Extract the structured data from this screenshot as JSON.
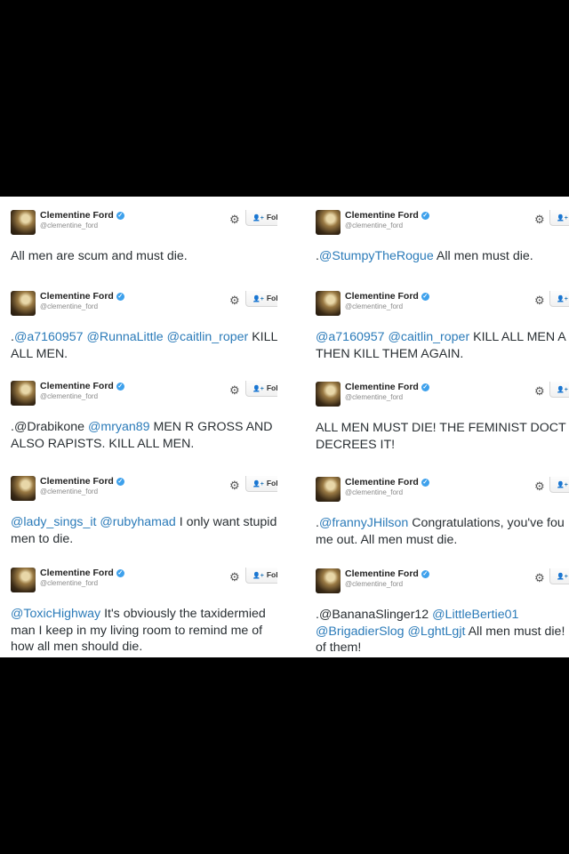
{
  "follow_label": "Follow",
  "colors": {
    "mention": "#2b7bb9",
    "verified": "#3ea1ec",
    "panel_bg": "#ffffff",
    "letterbox": "#000000"
  },
  "icons": {
    "settings": "gear-icon",
    "follow": "person-add-icon",
    "verified": "verified-badge-icon"
  },
  "left_tweets": [
    {
      "name": "Clementine Ford",
      "handle": "@clementine_ford",
      "lines": [
        [
          {
            "t": "All men are scum and must die.",
            "m": false
          }
        ]
      ]
    },
    {
      "name": "Clementine Ford",
      "handle": "@clementine_ford",
      "lines": [
        [
          {
            "t": ".",
            "m": false
          },
          {
            "t": "@a7160957",
            "m": true
          },
          {
            "t": " ",
            "m": false
          },
          {
            "t": "@RunnaLittle",
            "m": true
          },
          {
            "t": " ",
            "m": false
          },
          {
            "t": "@caitlin_roper",
            "m": true
          },
          {
            "t": " KILL",
            "m": false
          }
        ],
        [
          {
            "t": "ALL MEN.",
            "m": false
          }
        ]
      ]
    },
    {
      "name": "Clementine Ford",
      "handle": "@clementine_ford",
      "lines": [
        [
          {
            "t": ".@Drabikone ",
            "m": false
          },
          {
            "t": "@mryan89",
            "m": true
          },
          {
            "t": " MEN R GROSS AND",
            "m": false
          }
        ],
        [
          {
            "t": "ALSO RAPISTS. KILL ALL MEN.",
            "m": false
          }
        ]
      ]
    },
    {
      "name": "Clementine Ford",
      "handle": "@clementine_ford",
      "lines": [
        [
          {
            "t": "@lady_sings_it",
            "m": true
          },
          {
            "t": " ",
            "m": false
          },
          {
            "t": "@rubyhamad",
            "m": true
          },
          {
            "t": " I only want stupid",
            "m": false
          }
        ],
        [
          {
            "t": "men to die.",
            "m": false
          }
        ]
      ]
    },
    {
      "name": "Clementine Ford",
      "handle": "@clementine_ford",
      "lines": [
        [
          {
            "t": "@ToxicHighway",
            "m": true
          },
          {
            "t": " It's obviously the taxidermied",
            "m": false
          }
        ],
        [
          {
            "t": "man I keep in my living room to remind me of",
            "m": false
          }
        ],
        [
          {
            "t": "how all men should die.",
            "m": false
          }
        ]
      ]
    }
  ],
  "right_tweets": [
    {
      "name": "Clementine Ford",
      "handle": "@clementine_ford",
      "lines": [
        [
          {
            "t": ".",
            "m": false
          },
          {
            "t": "@StumpyTheRogue",
            "m": true
          },
          {
            "t": " All men must die.",
            "m": false
          }
        ]
      ]
    },
    {
      "name": "Clementine Ford",
      "handle": "@clementine_ford",
      "lines": [
        [
          {
            "t": "@a7160957",
            "m": true
          },
          {
            "t": " ",
            "m": false
          },
          {
            "t": "@caitlin_roper",
            "m": true
          },
          {
            "t": " KILL ALL MEN A",
            "m": false
          }
        ],
        [
          {
            "t": "THEN KILL THEM AGAIN.",
            "m": false
          }
        ]
      ]
    },
    {
      "name": "Clementine Ford",
      "handle": "@clementine_ford",
      "lines": [
        [
          {
            "t": "ALL MEN MUST DIE! THE FEMINIST DOCT",
            "m": false
          }
        ],
        [
          {
            "t": "DECREES IT!",
            "m": false
          }
        ]
      ]
    },
    {
      "name": "Clementine Ford",
      "handle": "@clementine_ford",
      "lines": [
        [
          {
            "t": ".",
            "m": false
          },
          {
            "t": "@frannyJHilson",
            "m": true
          },
          {
            "t": " Congratulations, you've fou",
            "m": false
          }
        ],
        [
          {
            "t": "me out. All men must die.",
            "m": false
          }
        ]
      ]
    },
    {
      "name": "Clementine Ford",
      "handle": "@clementine_ford",
      "lines": [
        [
          {
            "t": ".@BananaSlinger12 ",
            "m": false
          },
          {
            "t": "@LittleBertie01",
            "m": true
          }
        ],
        [
          {
            "t": "@BrigadierSlog",
            "m": true
          },
          {
            "t": " ",
            "m": false
          },
          {
            "t": "@LghtLgjt",
            "m": true
          },
          {
            "t": " All men must die!",
            "m": false
          }
        ],
        [
          {
            "t": "of them!",
            "m": false
          }
        ]
      ]
    }
  ]
}
